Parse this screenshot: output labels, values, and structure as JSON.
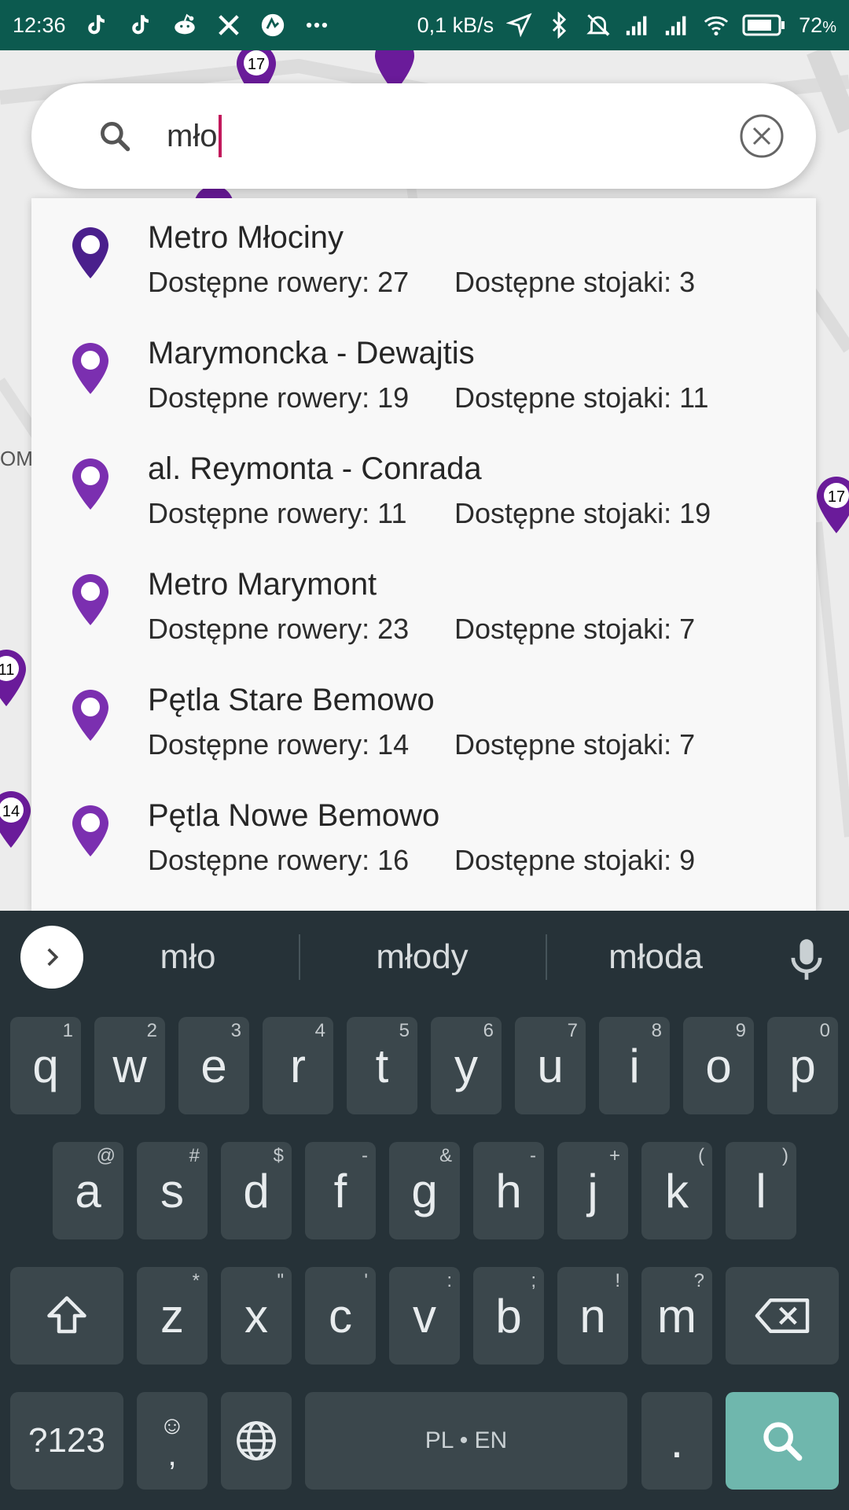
{
  "status_bar": {
    "time": "12:36",
    "network_speed": "0,1 kB/s",
    "battery_percent": "72",
    "battery_unit": "%",
    "notification_icons": [
      "tiktok-icon",
      "tiktok-icon",
      "reddit-icon",
      "x-icon",
      "app-icon",
      "more-icon"
    ],
    "system_icons": [
      "location-icon",
      "bluetooth-icon",
      "silent-icon",
      "signal-icon",
      "signal-icon",
      "wifi-icon",
      "battery-icon"
    ]
  },
  "map": {
    "pin_labels": [
      "17",
      "17",
      "11",
      "14"
    ],
    "edge_label": "OM"
  },
  "search": {
    "query": "mło",
    "icon": "search-icon",
    "clear_icon": "clear-circle-icon"
  },
  "suggestions": [
    {
      "name": "Metro Młociny",
      "bikes": "Dostępne rowery: 27",
      "racks": "Dostępne stojaki: 3"
    },
    {
      "name": "Marymoncka - Dewajtis",
      "bikes": "Dostępne rowery: 19",
      "racks": "Dostępne stojaki: 11"
    },
    {
      "name": "al. Reymonta - Conrada",
      "bikes": "Dostępne rowery: 11",
      "racks": "Dostępne stojaki: 19"
    },
    {
      "name": "Metro Marymont",
      "bikes": "Dostępne rowery: 23",
      "racks": "Dostępne stojaki: 7"
    },
    {
      "name": "Pętla Stare Bemowo",
      "bikes": "Dostępne rowery: 14",
      "racks": "Dostępne stojaki: 7"
    },
    {
      "name": "Pętla Nowe Bemowo",
      "bikes": "Dostępne rowery: 16",
      "racks": "Dostępne stojaki: 9"
    }
  ],
  "keyboard": {
    "predictions": [
      "mło",
      "młody",
      "młoda"
    ],
    "row1": [
      {
        "key": "q",
        "hint": "1"
      },
      {
        "key": "w",
        "hint": "2"
      },
      {
        "key": "e",
        "hint": "3"
      },
      {
        "key": "r",
        "hint": "4"
      },
      {
        "key": "t",
        "hint": "5"
      },
      {
        "key": "y",
        "hint": "6"
      },
      {
        "key": "u",
        "hint": "7"
      },
      {
        "key": "i",
        "hint": "8"
      },
      {
        "key": "o",
        "hint": "9"
      },
      {
        "key": "p",
        "hint": "0"
      }
    ],
    "row2": [
      {
        "key": "a",
        "hint": "@"
      },
      {
        "key": "s",
        "hint": "#"
      },
      {
        "key": "d",
        "hint": "$"
      },
      {
        "key": "f",
        "hint": "-"
      },
      {
        "key": "g",
        "hint": "&"
      },
      {
        "key": "h",
        "hint": "-"
      },
      {
        "key": "j",
        "hint": "+"
      },
      {
        "key": "k",
        "hint": "("
      },
      {
        "key": "l",
        "hint": ")"
      }
    ],
    "row3": [
      {
        "key": "z",
        "hint": "*"
      },
      {
        "key": "x",
        "hint": "\""
      },
      {
        "key": "c",
        "hint": "'"
      },
      {
        "key": "v",
        "hint": ":"
      },
      {
        "key": "b",
        "hint": ";"
      },
      {
        "key": "n",
        "hint": "!"
      },
      {
        "key": "m",
        "hint": "?"
      }
    ],
    "symbols_label": "?123",
    "comma_label": ",",
    "emoji_hint": "☺",
    "space_label": "PL • EN",
    "period_label": ".",
    "colors": {
      "background": "#263238",
      "key": "#3b474c",
      "action": "#6fb7ad"
    }
  },
  "colors": {
    "status_bar": "#0c5a4f",
    "pin_dark": "#4a1f8c",
    "pin": "#7b2fb0",
    "caret": "#c2185b"
  }
}
